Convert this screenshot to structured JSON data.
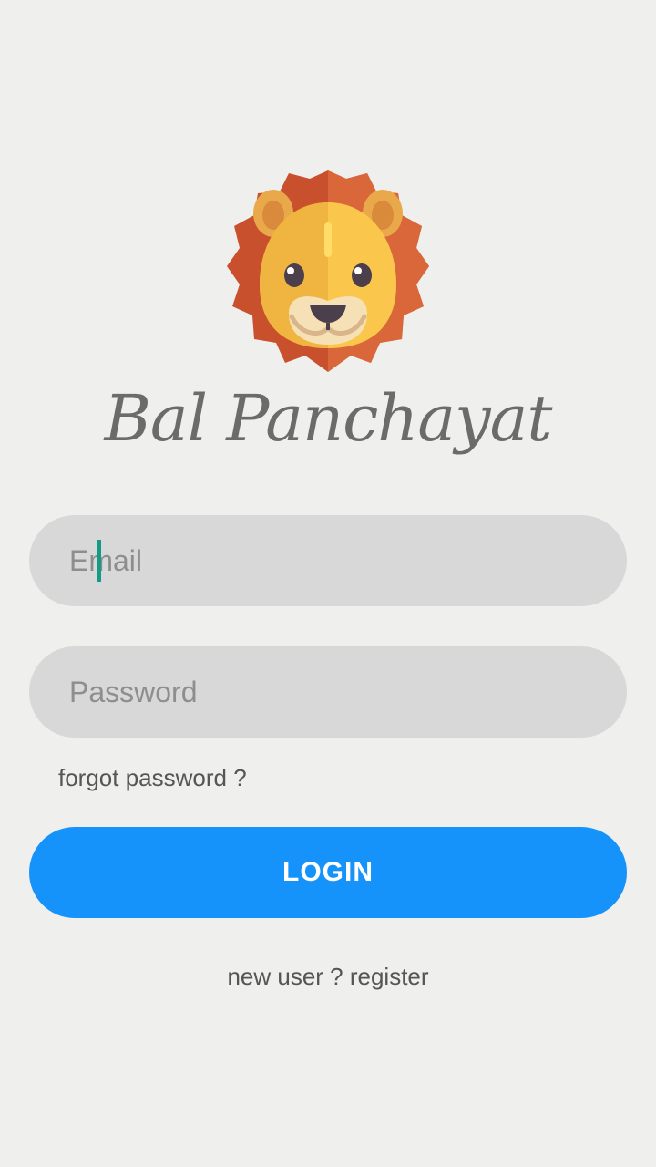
{
  "app": {
    "title": "Bal Panchayat",
    "logo_icon": "lion-face-icon"
  },
  "form": {
    "email": {
      "placeholder": "Email",
      "value": ""
    },
    "password": {
      "placeholder": "Password",
      "value": ""
    },
    "forgot_label": "forgot password ?",
    "login_label": "LOGIN",
    "register_label": "new user ? register"
  },
  "colors": {
    "background": "#efefed",
    "field_bg": "#d8d8d8",
    "accent": "#1593fb",
    "caret": "#159a87",
    "text": "#555555"
  }
}
